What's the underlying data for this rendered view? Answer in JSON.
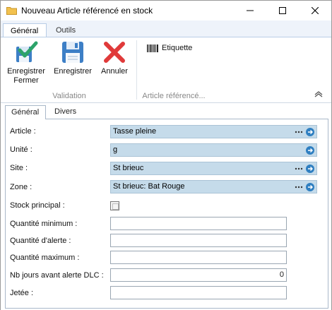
{
  "window": {
    "title": "Nouveau Article référencé en stock"
  },
  "ribbon": {
    "tabs": [
      {
        "label": "Général"
      },
      {
        "label": "Outils"
      }
    ],
    "buttons": {
      "save_close": "Enregistrer\nFermer",
      "save": "Enregistrer",
      "cancel": "Annuler",
      "etiquette": "Etiquette"
    },
    "groups": {
      "validation": "Validation",
      "article": "Article référencé..."
    }
  },
  "content": {
    "tabs": [
      {
        "label": "Général"
      },
      {
        "label": "Divers"
      }
    ]
  },
  "form": {
    "article": {
      "label": "Article :",
      "value": "Tasse pleine"
    },
    "unite": {
      "label": "Unité :",
      "value": "g"
    },
    "site": {
      "label": "Site :",
      "value": "St brieuc"
    },
    "zone": {
      "label": "Zone :",
      "value": "St brieuc: Bat Rouge"
    },
    "stock_principal": {
      "label": "Stock principal :",
      "checked": false
    },
    "qte_min": {
      "label": "Quantité minimum :",
      "value": ""
    },
    "qte_alerte": {
      "label": "Quantité d'alerte :",
      "value": ""
    },
    "qte_max": {
      "label": "Quantité maximum :",
      "value": ""
    },
    "nb_jours_dlc": {
      "label": "Nb jours avant alerte DLC :",
      "value": "0"
    },
    "jetee": {
      "label": "Jetée :",
      "value": ""
    }
  },
  "colors": {
    "lookup_bg": "#c5dbea",
    "accent": "#2f7fc1",
    "save_green": "#2da36a",
    "cancel_red": "#e03a3a"
  }
}
